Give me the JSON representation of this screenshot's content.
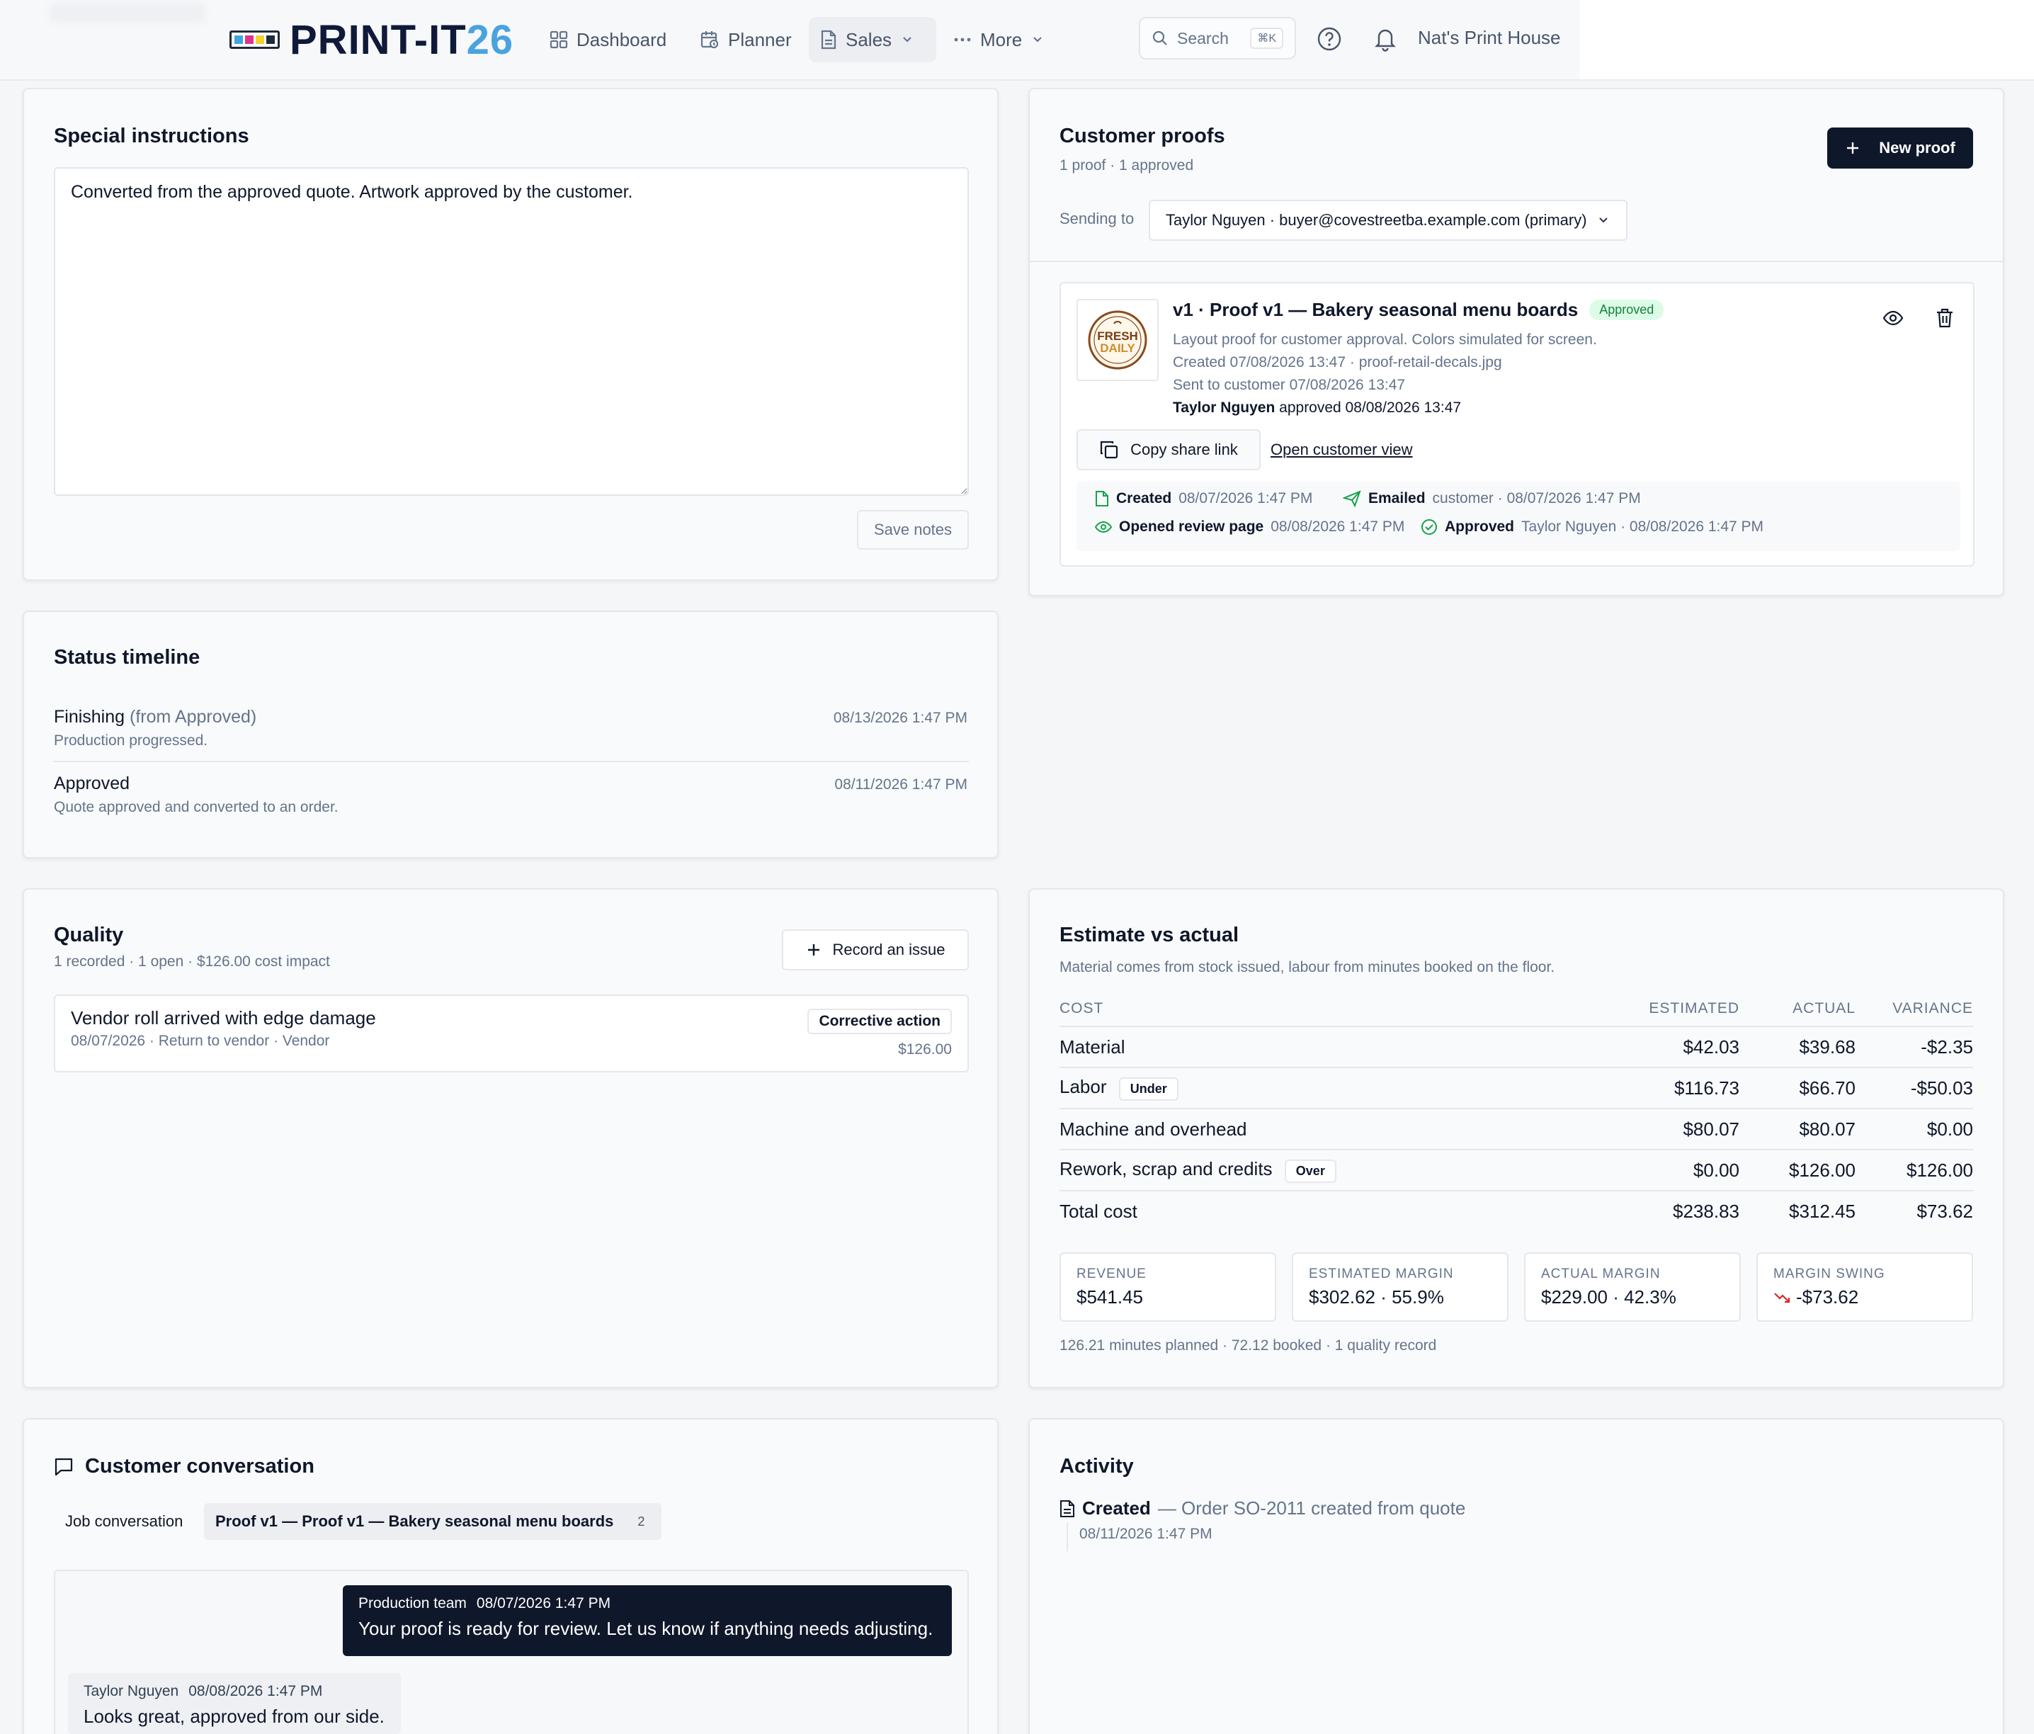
{
  "header": {
    "logo_text": "PRINT-IT",
    "logo_num": "26",
    "logo_colors": [
      "#3fa7e0",
      "#e0338f",
      "#f2d232",
      "#1e293b"
    ],
    "nav": [
      {
        "label": "Dashboard",
        "icon": "grid-icon"
      },
      {
        "label": "Planner",
        "icon": "calendar-icon"
      },
      {
        "label": "Sales",
        "icon": "document-icon"
      },
      {
        "label": "More",
        "icon": "more-icon"
      }
    ],
    "search_label": "Search",
    "search_kbd": "⌘K",
    "shop_name": "Nat's Print House"
  },
  "special_instructions": {
    "title": "Special instructions",
    "text": "Converted from the approved quote. Artwork approved by the customer.",
    "save_label": "Save notes"
  },
  "customer_proofs": {
    "title": "Customer proofs",
    "summary": "1 proof · 1 approved",
    "new_proof_label": "New proof",
    "sending_to_label": "Sending to",
    "sending_to_value": "Taylor Nguyen · buyer@covestreetba.example.com (primary)",
    "proof": {
      "thumb_text_1": "FRESH",
      "thumb_text_2": "DAILY",
      "title": "v1 · Proof v1 — Bakery seasonal menu boards",
      "status": "Approved",
      "description": "Layout proof for customer approval. Colors simulated for screen.",
      "created": "Created 07/08/2026 13:47 · proof-retail-decals.jpg",
      "sent": "Sent to customer 07/08/2026 13:47",
      "approved_by": "Taylor Nguyen",
      "approved_text": "approved 08/08/2026 13:47",
      "copy_link_label": "Copy share link",
      "open_view_label": "Open customer view",
      "events": [
        {
          "label": "Created",
          "detail": "08/07/2026 1:47 PM"
        },
        {
          "label": "Emailed",
          "detail": "customer · 08/07/2026 1:47 PM"
        },
        {
          "label": "Opened review page",
          "detail": "08/08/2026 1:47 PM"
        },
        {
          "label": "Approved",
          "detail": "Taylor Nguyen · 08/08/2026 1:47 PM"
        }
      ]
    }
  },
  "status_timeline": {
    "title": "Status timeline",
    "items": [
      {
        "status": "Finishing",
        "from": "(from Approved)",
        "note": "Production progressed.",
        "time": "08/13/2026 1:47 PM"
      },
      {
        "status": "Approved",
        "from": "",
        "note": "Quote approved and converted to an order.",
        "time": "08/11/2026 1:47 PM"
      }
    ]
  },
  "quality": {
    "title": "Quality",
    "summary": "1 recorded · 1 open · $126.00 cost impact",
    "record_label": "Record an issue",
    "issue": {
      "title": "Vendor roll arrived with edge damage",
      "meta": "08/07/2026 · Return to vendor · Vendor",
      "badge": "Corrective action",
      "amount": "$126.00"
    }
  },
  "estimate_vs_actual": {
    "title": "Estimate vs actual",
    "subtitle": "Material comes from stock issued, labour from minutes booked on the floor.",
    "columns": [
      "COST",
      "ESTIMATED",
      "ACTUAL",
      "VARIANCE"
    ],
    "rows": [
      {
        "label": "Material",
        "tag": "",
        "estimated": "$42.03",
        "actual": "$39.68",
        "variance": "-$2.35",
        "variance_tone": "neg"
      },
      {
        "label": "Labor",
        "tag": "Under",
        "estimated": "$116.73",
        "actual": "$66.70",
        "variance": "-$50.03",
        "variance_tone": "neg"
      },
      {
        "label": "Machine and overhead",
        "tag": "",
        "estimated": "$80.07",
        "actual": "$80.07",
        "variance": "$0.00",
        "variance_tone": "neg"
      },
      {
        "label": "Rework, scrap and credits",
        "tag": "Over",
        "estimated": "$0.00",
        "actual": "$126.00",
        "variance": "$126.00",
        "variance_tone": "red"
      },
      {
        "label": "Total cost",
        "tag": "",
        "estimated": "$238.83",
        "actual": "$312.45",
        "variance": "$73.62",
        "variance_tone": "red"
      }
    ],
    "kpis": [
      {
        "label": "REVENUE",
        "value": "$541.45"
      },
      {
        "label": "ESTIMATED MARGIN",
        "value": "$302.62 · 55.9%"
      },
      {
        "label": "ACTUAL MARGIN",
        "value": "$229.00 · 42.3%"
      },
      {
        "label": "MARGIN SWING",
        "value": "-$73.62"
      }
    ],
    "footer": "126.21 minutes planned · 72.12 booked · 1 quality record"
  },
  "conversation": {
    "title": "Customer conversation",
    "tabs": [
      {
        "label": "Job conversation",
        "count": ""
      },
      {
        "label": "Proof v1 — Proof v1 — Bakery seasonal menu boards",
        "count": "2"
      }
    ],
    "messages": [
      {
        "author": "Production team",
        "time": "08/07/2026 1:47 PM",
        "text": "Your proof is ready for review. Let us know if anything needs adjusting."
      },
      {
        "author": "Taylor Nguyen",
        "time": "08/08/2026 1:47 PM",
        "text": "Looks great, approved from our side."
      }
    ]
  },
  "activity": {
    "title": "Activity",
    "items": [
      {
        "label": "Created",
        "detail": "— Order SO-2011 created from quote",
        "time": "08/11/2026 1:47 PM"
      }
    ]
  }
}
